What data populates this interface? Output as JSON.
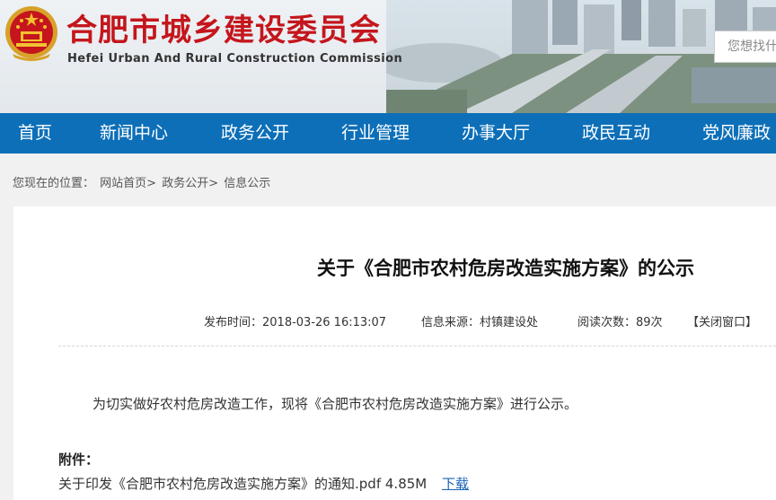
{
  "header": {
    "title": "合肥市城乡建设委员会",
    "subtitle": "Hefei Urban And Rural Construction Commission",
    "search_placeholder": "您想找什么"
  },
  "nav": {
    "items": [
      "首页",
      "新闻中心",
      "政务公开",
      "行业管理",
      "办事大厅",
      "政民互动",
      "党风廉政"
    ]
  },
  "breadcrumb": {
    "prefix": "您现在的位置：",
    "home": "网站首页>",
    "section": "政务公开>",
    "current": "信息公示"
  },
  "article": {
    "title": "关于《合肥市农村危房改造实施方案》的公示",
    "publish_time": "发布时间：2018-03-26 16:13:07",
    "source": "信息来源：村镇建设处",
    "views": "阅读次数：89次",
    "close": "【关闭窗口】",
    "body": "为切实做好农村危房改造工作，现将《合肥市农村危房改造实施方案》进行公示。",
    "attachment_label": "附件：",
    "attachment_name": "关于印发《合肥市农村危房改造实施方案》的通知.pdf",
    "attachment_size": "4.85M",
    "download_label": "下载"
  },
  "colors": {
    "brand_red": "#c4161c",
    "nav_blue": "#0d6fb8",
    "link_blue": "#1a64b5"
  }
}
